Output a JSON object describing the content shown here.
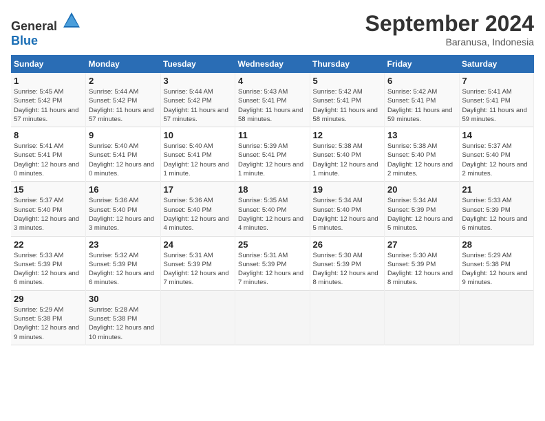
{
  "logo": {
    "text_general": "General",
    "text_blue": "Blue"
  },
  "title": {
    "month": "September 2024",
    "location": "Baranusa, Indonesia"
  },
  "calendar": {
    "headers": [
      "Sunday",
      "Monday",
      "Tuesday",
      "Wednesday",
      "Thursday",
      "Friday",
      "Saturday"
    ],
    "weeks": [
      [
        {
          "day": "1",
          "sunrise": "5:45 AM",
          "sunset": "5:42 PM",
          "daylight": "11 hours and 57 minutes."
        },
        {
          "day": "2",
          "sunrise": "5:44 AM",
          "sunset": "5:42 PM",
          "daylight": "11 hours and 57 minutes."
        },
        {
          "day": "3",
          "sunrise": "5:44 AM",
          "sunset": "5:42 PM",
          "daylight": "11 hours and 57 minutes."
        },
        {
          "day": "4",
          "sunrise": "5:43 AM",
          "sunset": "5:41 PM",
          "daylight": "11 hours and 58 minutes."
        },
        {
          "day": "5",
          "sunrise": "5:42 AM",
          "sunset": "5:41 PM",
          "daylight": "11 hours and 58 minutes."
        },
        {
          "day": "6",
          "sunrise": "5:42 AM",
          "sunset": "5:41 PM",
          "daylight": "11 hours and 59 minutes."
        },
        {
          "day": "7",
          "sunrise": "5:41 AM",
          "sunset": "5:41 PM",
          "daylight": "11 hours and 59 minutes."
        }
      ],
      [
        {
          "day": "8",
          "sunrise": "5:41 AM",
          "sunset": "5:41 PM",
          "daylight": "12 hours and 0 minutes."
        },
        {
          "day": "9",
          "sunrise": "5:40 AM",
          "sunset": "5:41 PM",
          "daylight": "12 hours and 0 minutes."
        },
        {
          "day": "10",
          "sunrise": "5:40 AM",
          "sunset": "5:41 PM",
          "daylight": "12 hours and 1 minute."
        },
        {
          "day": "11",
          "sunrise": "5:39 AM",
          "sunset": "5:41 PM",
          "daylight": "12 hours and 1 minute."
        },
        {
          "day": "12",
          "sunrise": "5:38 AM",
          "sunset": "5:40 PM",
          "daylight": "12 hours and 1 minute."
        },
        {
          "day": "13",
          "sunrise": "5:38 AM",
          "sunset": "5:40 PM",
          "daylight": "12 hours and 2 minutes."
        },
        {
          "day": "14",
          "sunrise": "5:37 AM",
          "sunset": "5:40 PM",
          "daylight": "12 hours and 2 minutes."
        }
      ],
      [
        {
          "day": "15",
          "sunrise": "5:37 AM",
          "sunset": "5:40 PM",
          "daylight": "12 hours and 3 minutes."
        },
        {
          "day": "16",
          "sunrise": "5:36 AM",
          "sunset": "5:40 PM",
          "daylight": "12 hours and 3 minutes."
        },
        {
          "day": "17",
          "sunrise": "5:36 AM",
          "sunset": "5:40 PM",
          "daylight": "12 hours and 4 minutes."
        },
        {
          "day": "18",
          "sunrise": "5:35 AM",
          "sunset": "5:40 PM",
          "daylight": "12 hours and 4 minutes."
        },
        {
          "day": "19",
          "sunrise": "5:34 AM",
          "sunset": "5:40 PM",
          "daylight": "12 hours and 5 minutes."
        },
        {
          "day": "20",
          "sunrise": "5:34 AM",
          "sunset": "5:39 PM",
          "daylight": "12 hours and 5 minutes."
        },
        {
          "day": "21",
          "sunrise": "5:33 AM",
          "sunset": "5:39 PM",
          "daylight": "12 hours and 6 minutes."
        }
      ],
      [
        {
          "day": "22",
          "sunrise": "5:33 AM",
          "sunset": "5:39 PM",
          "daylight": "12 hours and 6 minutes."
        },
        {
          "day": "23",
          "sunrise": "5:32 AM",
          "sunset": "5:39 PM",
          "daylight": "12 hours and 6 minutes."
        },
        {
          "day": "24",
          "sunrise": "5:31 AM",
          "sunset": "5:39 PM",
          "daylight": "12 hours and 7 minutes."
        },
        {
          "day": "25",
          "sunrise": "5:31 AM",
          "sunset": "5:39 PM",
          "daylight": "12 hours and 7 minutes."
        },
        {
          "day": "26",
          "sunrise": "5:30 AM",
          "sunset": "5:39 PM",
          "daylight": "12 hours and 8 minutes."
        },
        {
          "day": "27",
          "sunrise": "5:30 AM",
          "sunset": "5:39 PM",
          "daylight": "12 hours and 8 minutes."
        },
        {
          "day": "28",
          "sunrise": "5:29 AM",
          "sunset": "5:38 PM",
          "daylight": "12 hours and 9 minutes."
        }
      ],
      [
        {
          "day": "29",
          "sunrise": "5:29 AM",
          "sunset": "5:38 PM",
          "daylight": "12 hours and 9 minutes."
        },
        {
          "day": "30",
          "sunrise": "5:28 AM",
          "sunset": "5:38 PM",
          "daylight": "12 hours and 10 minutes."
        },
        null,
        null,
        null,
        null,
        null
      ]
    ]
  }
}
